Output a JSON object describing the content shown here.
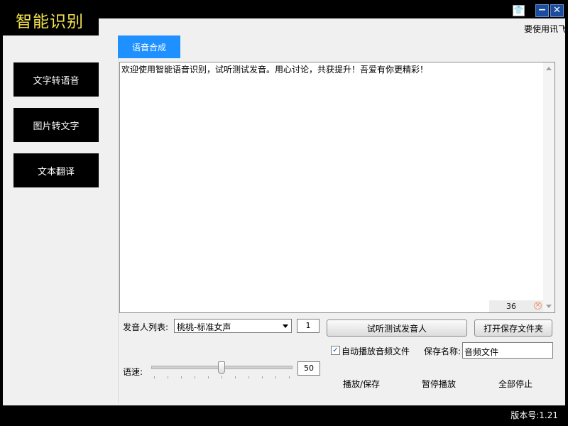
{
  "app": {
    "title": "智能识别",
    "notice": "要使用讯飞"
  },
  "window_controls": {
    "skin": "👕",
    "minimize": "−",
    "close": "✕"
  },
  "sidebar": {
    "items": [
      {
        "label": "文字转语音"
      },
      {
        "label": "图片转文字"
      },
      {
        "label": "文本翻译"
      }
    ]
  },
  "tabs": [
    {
      "label": "语音合成",
      "active": true
    }
  ],
  "editor": {
    "text": "欢迎使用智能语音识别，试听测试发音。用心讨论，共获提升！吾爱有你更精彩！",
    "char_count": "36"
  },
  "voice": {
    "label": "发音人列表:",
    "selected": "桃桃-标准女声",
    "count": "1",
    "test_button": "试听测试发音人",
    "open_folder_button": "打开保存文件夹"
  },
  "autoplay": {
    "label": "自动播放音频文件",
    "checked": true
  },
  "save_name": {
    "label": "保存名称:",
    "value": "音频文件"
  },
  "speed": {
    "label": "语速:",
    "value": "50",
    "fraction": 0.5
  },
  "actions": {
    "play_save": "播放/保存",
    "pause": "暂停播放",
    "stop_all": "全部停止"
  },
  "status": {
    "version": "版本号:1.21"
  },
  "colors": {
    "accent": "#1e90ff",
    "title": "#f2e24c",
    "background": "#f0f0f0"
  }
}
